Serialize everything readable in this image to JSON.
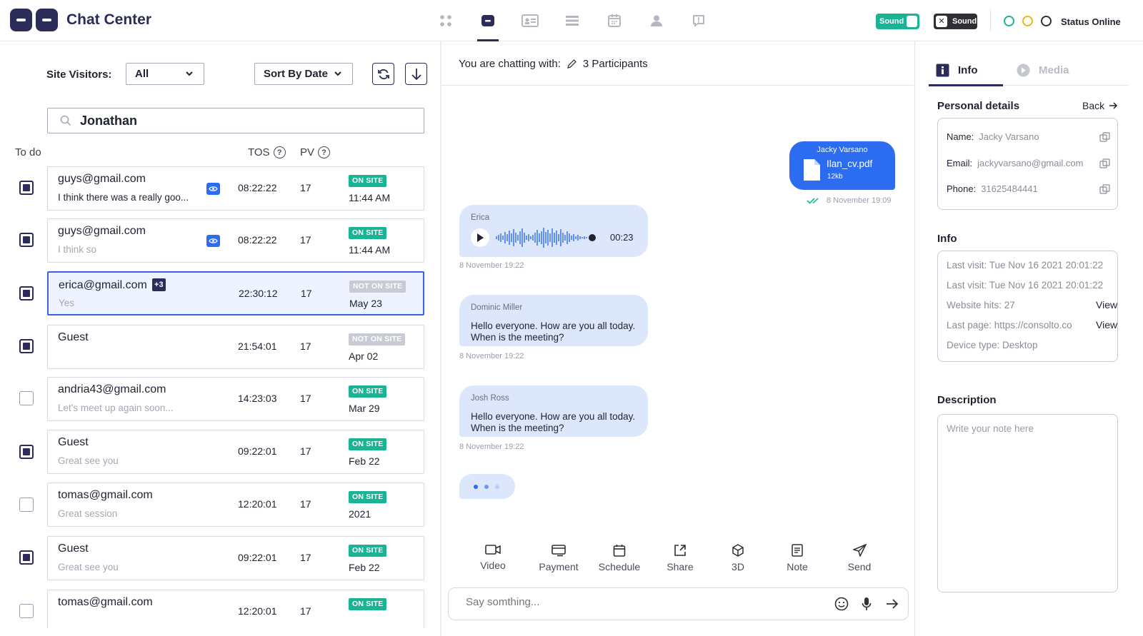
{
  "app": {
    "title": "Chat Center"
  },
  "topbar": {
    "nav_icons": [
      "grid-icon",
      "chat-icon",
      "contact-card-icon",
      "list-icon",
      "calendar-icon",
      "user-icon",
      "feedback-icon"
    ],
    "sound_on_label": "Sound",
    "sound_off_label": "Sound",
    "status_label": "Status Online",
    "status_colors": [
      "#1ab394",
      "#f5b50a",
      "#2f3036"
    ]
  },
  "filters": {
    "site_visitors_label": "Site Visitors:",
    "site_visitors_value": "All",
    "sort_value": "Sort By Date",
    "search_value": "Jonathan"
  },
  "list_headers": {
    "todo": "To do",
    "tos": "TOS",
    "pv": "PV"
  },
  "visitors": [
    {
      "email": "guys@gmail.com",
      "message": "I think there was a really goo...",
      "tos": "08:22:22",
      "pv": "17",
      "status": "ON SITE",
      "date": "11:44 AM",
      "checked": true,
      "eye": true
    },
    {
      "email": "guys@gmail.com",
      "message": "I think so",
      "tos": "08:22:22",
      "pv": "17",
      "status": "ON SITE",
      "date": "11:44 AM",
      "checked": true,
      "eye": true
    },
    {
      "email": "erica@gmail.com",
      "plus": "+3",
      "message": "Yes",
      "tos": "22:30:12",
      "pv": "17",
      "status": "NOT ON SITE",
      "date": "May 23",
      "checked": true,
      "selected": true
    },
    {
      "email": "Guest",
      "message": "",
      "tos": "21:54:01",
      "pv": "17",
      "status": "NOT ON SITE",
      "date": "Apr 02",
      "checked": true
    },
    {
      "email": "andria43@gmail.com",
      "message": "Let's meet up again soon...",
      "tos": "14:23:03",
      "pv": "17",
      "status": "ON SITE",
      "date": "Mar 29",
      "checked": false
    },
    {
      "email": "Guest",
      "message": "Great see you",
      "tos": "09:22:01",
      "pv": "17",
      "status": "ON SITE",
      "date": "Feb 22",
      "checked": true
    },
    {
      "email": "tomas@gmail.com",
      "message": "Great session",
      "tos": "12:20:01",
      "pv": "17",
      "status": "ON SITE",
      "date": "2021",
      "checked": false
    },
    {
      "email": "Guest",
      "message": "Great see you",
      "tos": "09:22:01",
      "pv": "17",
      "status": "ON SITE",
      "date": "Feb 22",
      "checked": true
    },
    {
      "email": "tomas@gmail.com",
      "message": "",
      "tos": "12:20:01",
      "pv": "17",
      "status": "ON SITE",
      "date": "",
      "checked": false
    }
  ],
  "chat": {
    "header_prefix": "You are chatting with:",
    "participants": "3 Participants",
    "outgoing": {
      "sender": "Jacky Varsano",
      "file_name": "Ilan_cv.pdf",
      "file_size": "12kb",
      "time": "8 November 19:09"
    },
    "audio": {
      "sender": "Erica",
      "duration": "00:23",
      "time": "8 November 19:22"
    },
    "messages": [
      {
        "sender": "Dominic Miller",
        "line1": "Hello everyone. How are you all today.",
        "line2": "When is the meeting?",
        "time": "8 November 19:22"
      },
      {
        "sender": "Josh Ross",
        "line1": "Hello everyone. How are you all today.",
        "line2": "When is the meeting?",
        "time": "8 November 19:22"
      }
    ],
    "actions": [
      "Video",
      "Payment",
      "Schedule",
      "Share",
      "3D",
      "Note",
      "Send"
    ],
    "composer_placeholder": "Say somthing..."
  },
  "right_panel": {
    "tab_info": "Info",
    "tab_media": "Media",
    "personal_title": "Personal details",
    "back_label": "Back",
    "name_label": "Name:",
    "name_value": "Jacky Varsano",
    "email_label": "Email:",
    "email_value": "jackyvarsano@gmail.com",
    "phone_label": "Phone:",
    "phone_value": "31625484441",
    "info_title": "Info",
    "info_rows": [
      "Last visit: Tue Nov 16 2021 20:01:22",
      "Last visit: Tue Nov 16 2021 20:01:22",
      "Website hits: 27",
      "Last page: https://consolto.co",
      "Device type: Desktop"
    ],
    "view_label": "View",
    "description_title": "Description",
    "note_placeholder": "Write your note here"
  }
}
